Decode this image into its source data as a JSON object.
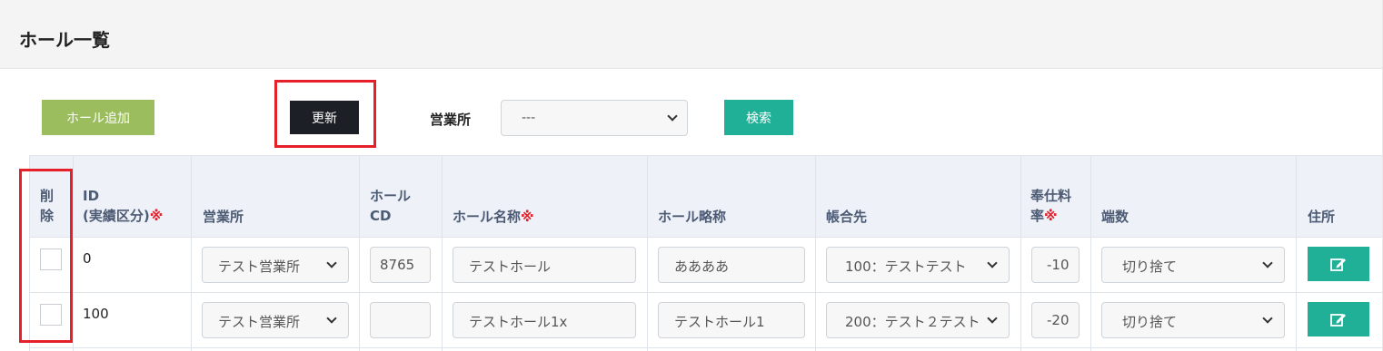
{
  "page": {
    "title": "ホール一覧"
  },
  "toolbar": {
    "add_label": "ホール追加",
    "update_label": "更新",
    "office_label": "営業所",
    "office_value": "---",
    "search_label": "検索"
  },
  "table": {
    "headers": {
      "delete": [
        "削",
        "除"
      ],
      "id": [
        "ID",
        "(実績区分)"
      ],
      "office": "営業所",
      "hall_cd": [
        "ホール",
        "CD"
      ],
      "hall_name": "ホール名称",
      "hall_short": "ホール略称",
      "account": "帳合先",
      "fee_rate": [
        "奉仕料",
        "率"
      ],
      "fraction": "端数",
      "address": "住所",
      "required_mark": "※"
    },
    "rows": [
      {
        "id": "0",
        "office": "テスト営業所",
        "hall_cd": "8765",
        "hall_name": "テストホール",
        "hall_short": "ああああ",
        "account": "100：テストテスト",
        "fee_rate": "-10",
        "fraction": "切り捨て"
      },
      {
        "id": "100",
        "office": "テスト営業所",
        "hall_cd": "",
        "hall_name": "テストホール1x",
        "hall_short": "テストホール1",
        "account": "200：テスト２テスト",
        "fee_rate": "-20",
        "fraction": "切り捨て"
      }
    ]
  },
  "icons": {
    "edit": "edit-icon",
    "dropdown": "chevron-down-icon"
  },
  "colors": {
    "add": "#9bbd5d",
    "update": "#1c1f26",
    "search": "#1fb097",
    "highlight": "#e5202b"
  }
}
